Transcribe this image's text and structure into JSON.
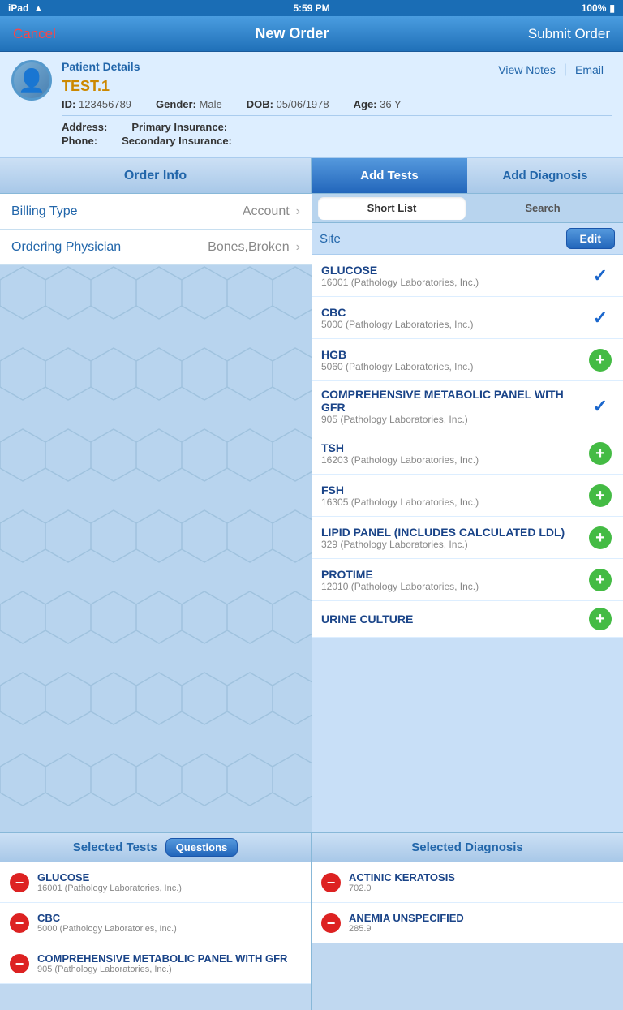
{
  "statusBar": {
    "carrier": "iPad",
    "wifi": "wifi",
    "time": "5:59 PM",
    "battery": "100%"
  },
  "navBar": {
    "cancelLabel": "Cancel",
    "title": "New Order",
    "submitLabel": "Submit Order"
  },
  "patientSection": {
    "label": "Patient Details",
    "viewNotesLabel": "View Notes",
    "emailLabel": "Email",
    "name": "TEST.1",
    "idLabel": "ID:",
    "idValue": "123456789",
    "genderLabel": "Gender:",
    "genderValue": "Male",
    "dobLabel": "DOB:",
    "dobValue": "05/06/1978",
    "ageLabel": "Age:",
    "ageValue": "36 Y",
    "addressLabel": "Address:",
    "phoneLabel": "Phone:",
    "primaryInsuranceLabel": "Primary Insurance:",
    "secondaryInsuranceLabel": "Secondary Insurance:"
  },
  "leftPanel": {
    "headerTitle": "Order Info",
    "billingTypeLabel": "Billing Type",
    "billingTypeValue": "Account",
    "orderingPhysicianLabel": "Ordering Physician",
    "orderingPhysicianValue": "Bones,Broken"
  },
  "rightPanel": {
    "tabs": [
      {
        "id": "add-tests",
        "label": "Add Tests",
        "active": true
      },
      {
        "id": "add-diagnosis",
        "label": "Add Diagnosis",
        "active": false
      }
    ],
    "subTabs": [
      {
        "id": "short-list",
        "label": "Short List",
        "active": true
      },
      {
        "id": "search",
        "label": "Search",
        "active": false
      }
    ],
    "siteLabel": "Site",
    "editLabel": "Edit",
    "tests": [
      {
        "id": "glucose",
        "name": "GLUCOSE",
        "sub": "16001 (Pathology Laboratories, Inc.)",
        "status": "checked"
      },
      {
        "id": "cbc",
        "name": "CBC",
        "sub": "5000 (Pathology Laboratories, Inc.)",
        "status": "checked"
      },
      {
        "id": "hgb",
        "name": "HGB",
        "sub": "5060 (Pathology Laboratories, Inc.)",
        "status": "plus"
      },
      {
        "id": "comp-metabolic",
        "name": "COMPREHENSIVE METABOLIC PANEL WITH GFR",
        "sub": "905 (Pathology Laboratories, Inc.)",
        "status": "checked"
      },
      {
        "id": "tsh",
        "name": "TSH",
        "sub": "16203 (Pathology Laboratories, Inc.)",
        "status": "plus"
      },
      {
        "id": "fsh",
        "name": "FSH",
        "sub": "16305 (Pathology Laboratories, Inc.)",
        "status": "plus"
      },
      {
        "id": "lipid-panel",
        "name": "LIPID PANEL (INCLUDES CALCULATED LDL)",
        "sub": "329 (Pathology Laboratories, Inc.)",
        "status": "plus"
      },
      {
        "id": "protime",
        "name": "PROTIME",
        "sub": "12010 (Pathology Laboratories, Inc.)",
        "status": "plus"
      },
      {
        "id": "urine-culture",
        "name": "URINE CULTURE",
        "sub": "",
        "status": "plus"
      }
    ]
  },
  "bottomLeft": {
    "headerTitle": "Selected Tests",
    "questionsLabel": "Questions",
    "items": [
      {
        "id": "sel-glucose",
        "name": "GLUCOSE",
        "sub": "16001 (Pathology Laboratories, Inc.)"
      },
      {
        "id": "sel-cbc",
        "name": "CBC",
        "sub": "5000 (Pathology Laboratories, Inc.)"
      },
      {
        "id": "sel-comp-metabolic",
        "name": "COMPREHENSIVE METABOLIC PANEL WITH GFR",
        "sub": "905 (Pathology Laboratories, Inc.)"
      }
    ]
  },
  "bottomRight": {
    "headerTitle": "Selected Diagnosis",
    "items": [
      {
        "id": "sel-actinic",
        "name": "ACTINIC KERATOSIS",
        "sub": "702.0"
      },
      {
        "id": "sel-anemia",
        "name": "ANEMIA UNSPECIFIED",
        "sub": "285.9"
      }
    ]
  }
}
